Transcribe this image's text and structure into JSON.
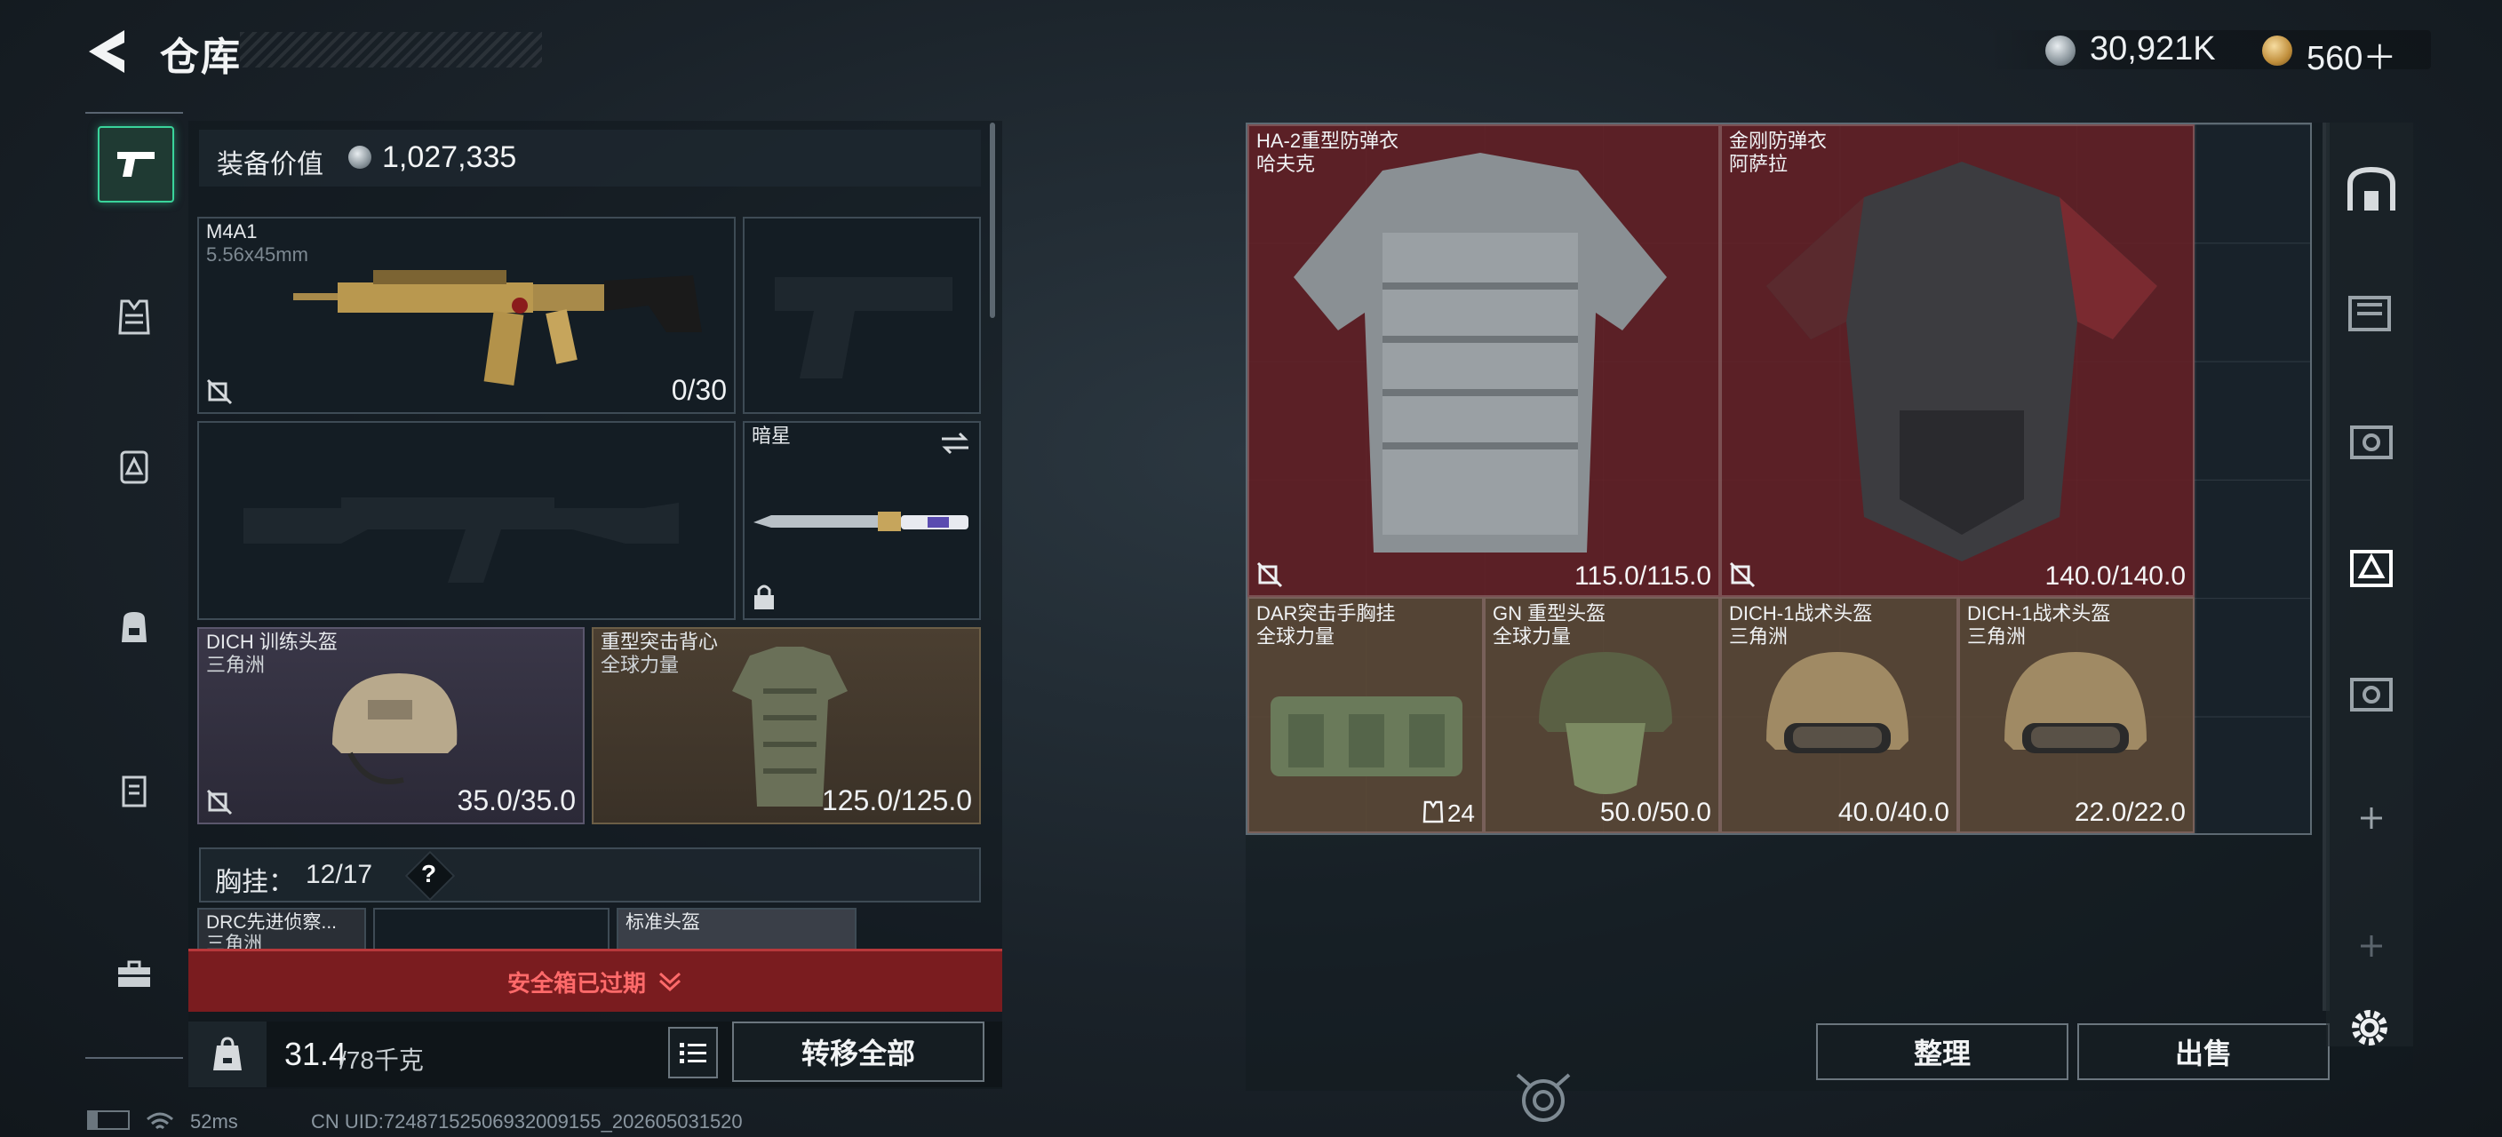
{
  "header": {
    "title": "仓库",
    "currency": [
      {
        "icon": "silver-coin-icon",
        "value": "30,921K"
      },
      {
        "icon": "gold-coin-icon",
        "value": "560＋"
      }
    ]
  },
  "loadout": {
    "value_label": "装备价值",
    "value": "1,027,335",
    "primary": {
      "name": "M4A1",
      "caliber": "5.56x45mm",
      "ammo": "0/30"
    },
    "melee": {
      "name": "暗星"
    },
    "helmet": {
      "name": "DICH 训练头盔",
      "faction": "三角洲",
      "durability": "35.0/35.0"
    },
    "armor": {
      "name": "重型突击背心",
      "faction": "全球力量",
      "durability": "125.0/125.0"
    },
    "chest": {
      "label": "胸挂：",
      "capacity": "12/17",
      "help": "?"
    },
    "chest_items": [
      {
        "name": "DRC先进侦察...",
        "faction": "三角洲"
      },
      {
        "name": "标准头盔"
      }
    ],
    "secure_box": "安全箱已过期",
    "weight": "31.4",
    "weight_max": "/78千克",
    "transfer_all": "转移全部"
  },
  "stash": {
    "items": [
      {
        "name": "HA-2重型防弹衣",
        "faction": "哈夫克",
        "value": "115.0/115.0"
      },
      {
        "name": "金刚防弹衣",
        "faction": "阿萨拉",
        "value": "140.0/140.0"
      },
      {
        "name": "DAR突击手胸挂",
        "faction": "全球力量",
        "value": "24"
      },
      {
        "name": "GN 重型头盔",
        "faction": "全球力量",
        "value": "50.0/50.0"
      },
      {
        "name": "DICH-1战术头盔",
        "faction": "三角洲",
        "value": "40.0/40.0"
      },
      {
        "name": "DICH-1战术头盔",
        "faction": "三角洲",
        "value": "22.0/22.0"
      }
    ],
    "sort_button": "整理",
    "sell_button": "出售"
  },
  "status": {
    "ping": "52ms",
    "uid": "CN UID:7248715250693200915​5_202605031520"
  },
  "colors": {
    "accent": "#3ad49b",
    "rare_red": "#64202a",
    "epic_gold": "#5a4836",
    "expired": "#7a1c1f"
  }
}
